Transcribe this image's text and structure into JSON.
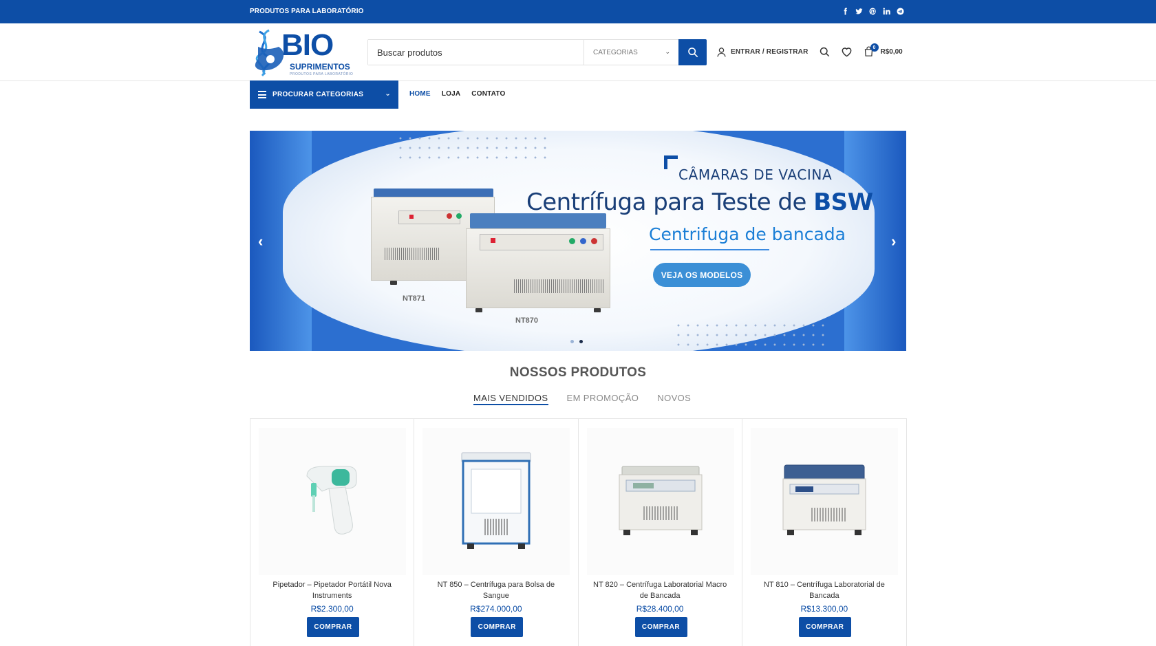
{
  "topbar": {
    "tagline": "PRODUTOS PARA LABORATÓRIO",
    "socials": [
      "facebook-icon",
      "twitter-icon",
      "pinterest-icon",
      "linkedin-icon",
      "telegram-icon"
    ]
  },
  "logo": {
    "main": "BIO",
    "secondary": "SUPRIMENTOS",
    "tagline": "PRODUTOS PARA LABORATÓRIO"
  },
  "search": {
    "placeholder": "Buscar produtos",
    "category_label": "CATEGORIAS"
  },
  "header": {
    "login_label": "ENTRAR / REGISTRAR",
    "cart_count": "0",
    "cart_total": "R$0,00"
  },
  "nav": {
    "categories_label": "PROCURAR CATEGORIAS",
    "links": [
      "HOME",
      "LOJA",
      "CONTATO"
    ]
  },
  "banner": {
    "kicker": "CÂMARAS DE VACINA",
    "headline_prefix": "Centrífuga para Teste de ",
    "headline_bold": "BSW",
    "subheadline": "Centrifuga de bancada",
    "cta": "VEJA OS MODELOS",
    "model_a": "NT871",
    "model_b": "NT870",
    "active_slide": 2,
    "slide_count": 2
  },
  "products_section": {
    "title": "NOSSOS PRODUTOS",
    "tabs": [
      "MAIS VENDIDOS",
      "EM PROMOÇÃO",
      "NOVOS"
    ],
    "active_tab": "MAIS VENDIDOS",
    "buy_label": "COMPRAR",
    "items": [
      {
        "name": "Pipetador – Pipetador Portátil Nova Instruments",
        "price": "R$2.300,00"
      },
      {
        "name": "NT 850 – Centrífuga para Bolsa de Sangue",
        "price": "R$274.000,00"
      },
      {
        "name": "NT 820 – Centrífuga Laboratorial Macro de Bancada",
        "price": "R$28.400,00"
      },
      {
        "name": "NT 810 – Centrífuga Laboratorial de Bancada",
        "price": "R$13.300,00"
      }
    ]
  },
  "colors": {
    "brand": "#0d4ea6",
    "text": "#242424"
  }
}
